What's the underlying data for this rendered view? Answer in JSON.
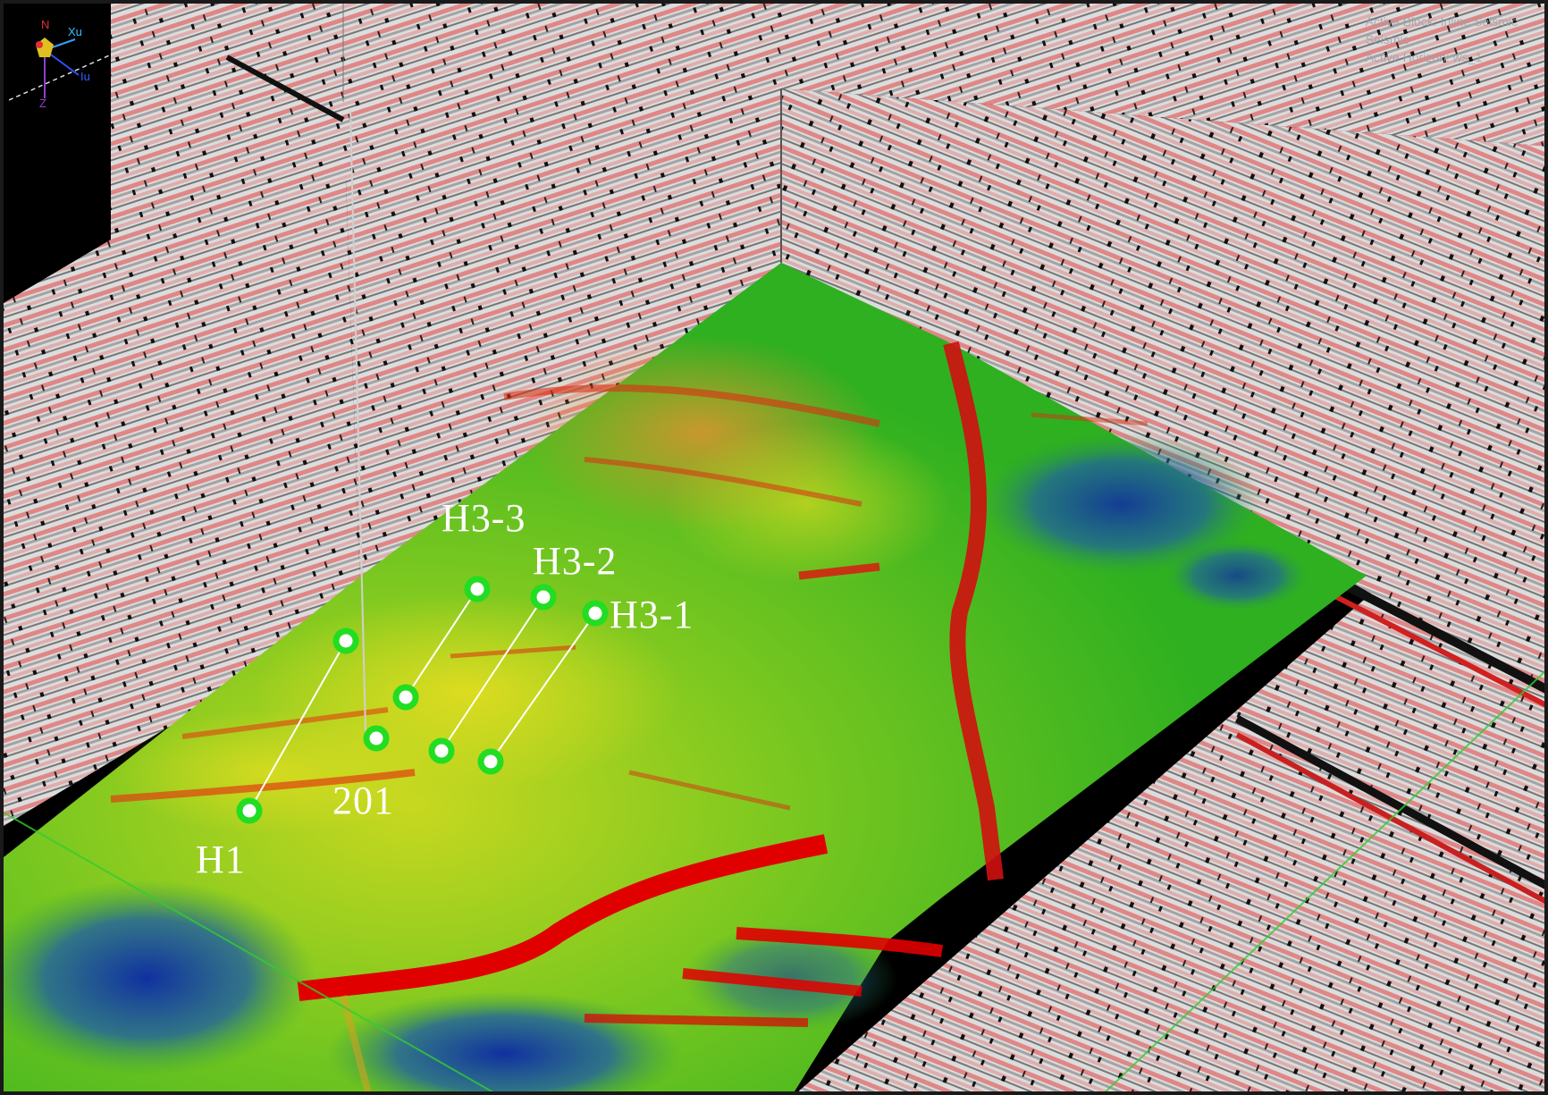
{
  "viewer": {
    "hud_lines": [
      "Active Block: Inline Seismic",
      "Seismic",
      "Active Horizon: ws_1"
    ],
    "compass": {
      "north": "N",
      "x_axis": "Xu",
      "y_axis": "Iu",
      "z_axis": "Z"
    }
  },
  "wells": [
    {
      "id": "H1",
      "label": "H1"
    },
    {
      "id": "201",
      "label": "201"
    },
    {
      "id": "H3-3",
      "label": "H3-3"
    },
    {
      "id": "H3-2",
      "label": "H3-2"
    },
    {
      "id": "H3-1",
      "label": "H3-1"
    }
  ],
  "colors": {
    "seismic_base": "#d9d9d9",
    "seismic_red": "#e05050",
    "seismic_black": "#111111",
    "horizon_high": "#e01010",
    "horizon_mid": "#e8e020",
    "horizon_low": "#30b820",
    "horizon_deep": "#1030a0",
    "well_marker": "#22dd22",
    "grid_line": "#33cc33"
  }
}
